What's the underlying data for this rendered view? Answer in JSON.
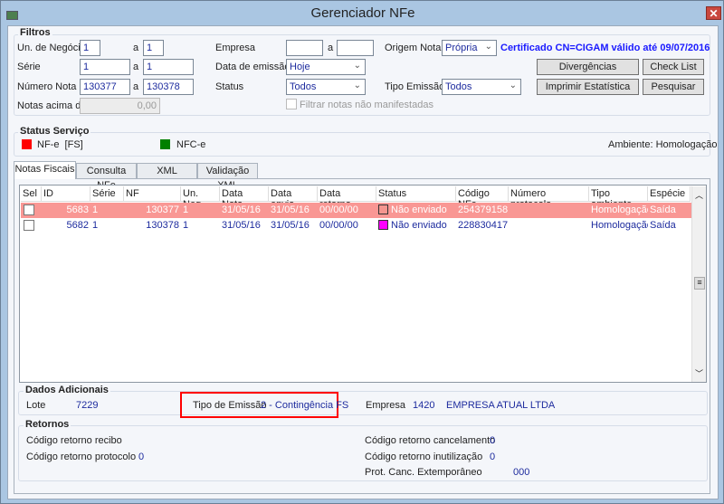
{
  "window": {
    "title": "Gerenciador NFe",
    "close_label": "✕"
  },
  "filtros": {
    "title": "Filtros",
    "un_negocio": {
      "label": "Un. de Negócio",
      "from": "1",
      "to": "1"
    },
    "serie": {
      "label": "Série",
      "from": "1",
      "to": "1"
    },
    "numero_nota": {
      "label": "Número Nota",
      "from": "130377",
      "to": "130378"
    },
    "notas_acima": {
      "label": "Notas acima de",
      "value": "0,00"
    },
    "range_sep": "a",
    "empresa": {
      "label": "Empresa",
      "from": "",
      "to": ""
    },
    "data_emissao": {
      "label": "Data de emissão",
      "value": "Hoje"
    },
    "status": {
      "label": "Status",
      "value": "Todos"
    },
    "filtrar_nao_manifestadas": {
      "label": "Filtrar notas não manifestadas",
      "checked": false
    },
    "origem_nota": {
      "label": "Origem Nota",
      "value": "Própria"
    },
    "tipo_emissao": {
      "label": "Tipo Emissão",
      "value": "Todos"
    },
    "certificado": "Certificado CN=CIGAM válido até 09/07/2016",
    "buttons": {
      "divergencias": "Divergências",
      "check_list": "Check List",
      "imprimir": "Imprimir Estatística",
      "pesquisar": "Pesquisar"
    }
  },
  "status_servico": {
    "title": "Status Serviço",
    "nfe": {
      "label": "NF-e  [FS]",
      "color": "#ff0000"
    },
    "nfce": {
      "label": "NFC-e",
      "color": "#008000"
    },
    "ambiente": "Ambiente: Homologação"
  },
  "tabs": [
    {
      "label": "Notas Fiscais",
      "active": true
    },
    {
      "label": "Consulta NFe"
    },
    {
      "label": "XML"
    },
    {
      "label": "Validação XML"
    }
  ],
  "grid": {
    "columns": [
      "Sel",
      "ID",
      "Série",
      "NF",
      "Un. Neg.",
      "Data Nota",
      "Data envio",
      "Data retorno",
      "Status",
      "Código NFe",
      "Número protocolo",
      "Tipo ambiente",
      "Espécie"
    ],
    "rows": [
      {
        "id": "5683",
        "serie": "1",
        "nf": "130377",
        "un_neg": "1",
        "data_nota": "31/05/16",
        "data_envio": "31/05/16",
        "data_retorno": "00/00/00",
        "status": "Não enviado",
        "status_color": "#f4958f",
        "codigo_nfe": "254379158",
        "protocolo": "",
        "tipo_ambiente": "Homologação",
        "especie": "Saída",
        "selected": true,
        "checked": false
      },
      {
        "id": "5682",
        "serie": "1",
        "nf": "130378",
        "un_neg": "1",
        "data_nota": "31/05/16",
        "data_envio": "31/05/16",
        "data_retorno": "00/00/00",
        "status": "Não enviado",
        "status_color": "#ff00ff",
        "codigo_nfe": "228830417",
        "protocolo": "",
        "tipo_ambiente": "Homologação",
        "especie": "Saída",
        "selected": false,
        "checked": false
      }
    ],
    "selected_row_color": "#f99794"
  },
  "dados_adicionais": {
    "title": "Dados Adicionais",
    "lote_label": "Lote",
    "lote": "7229",
    "tipo_emissao_label": "Tipo de Emissão",
    "tipo_emissao": "2 - Contingência FS",
    "empresa_label": "Empresa",
    "empresa_codigo": "1420",
    "empresa_nome": "EMPRESA ATUAL LTDA",
    "highlight_color": "#ff0000"
  },
  "retornos": {
    "title": "Retornos",
    "recibo_label": "Código retorno recibo",
    "recibo": "",
    "protocolo_label": "Código retorno protocolo",
    "protocolo": "0",
    "cancelamento_label": "Código retorno cancelamento",
    "cancelamento": "0",
    "inutilizacao_label": "Código retorno inutilização",
    "inutilizacao": "0",
    "extemporaneo_label": "Prot. Canc. Extemporâneo",
    "extemporaneo": "000"
  }
}
